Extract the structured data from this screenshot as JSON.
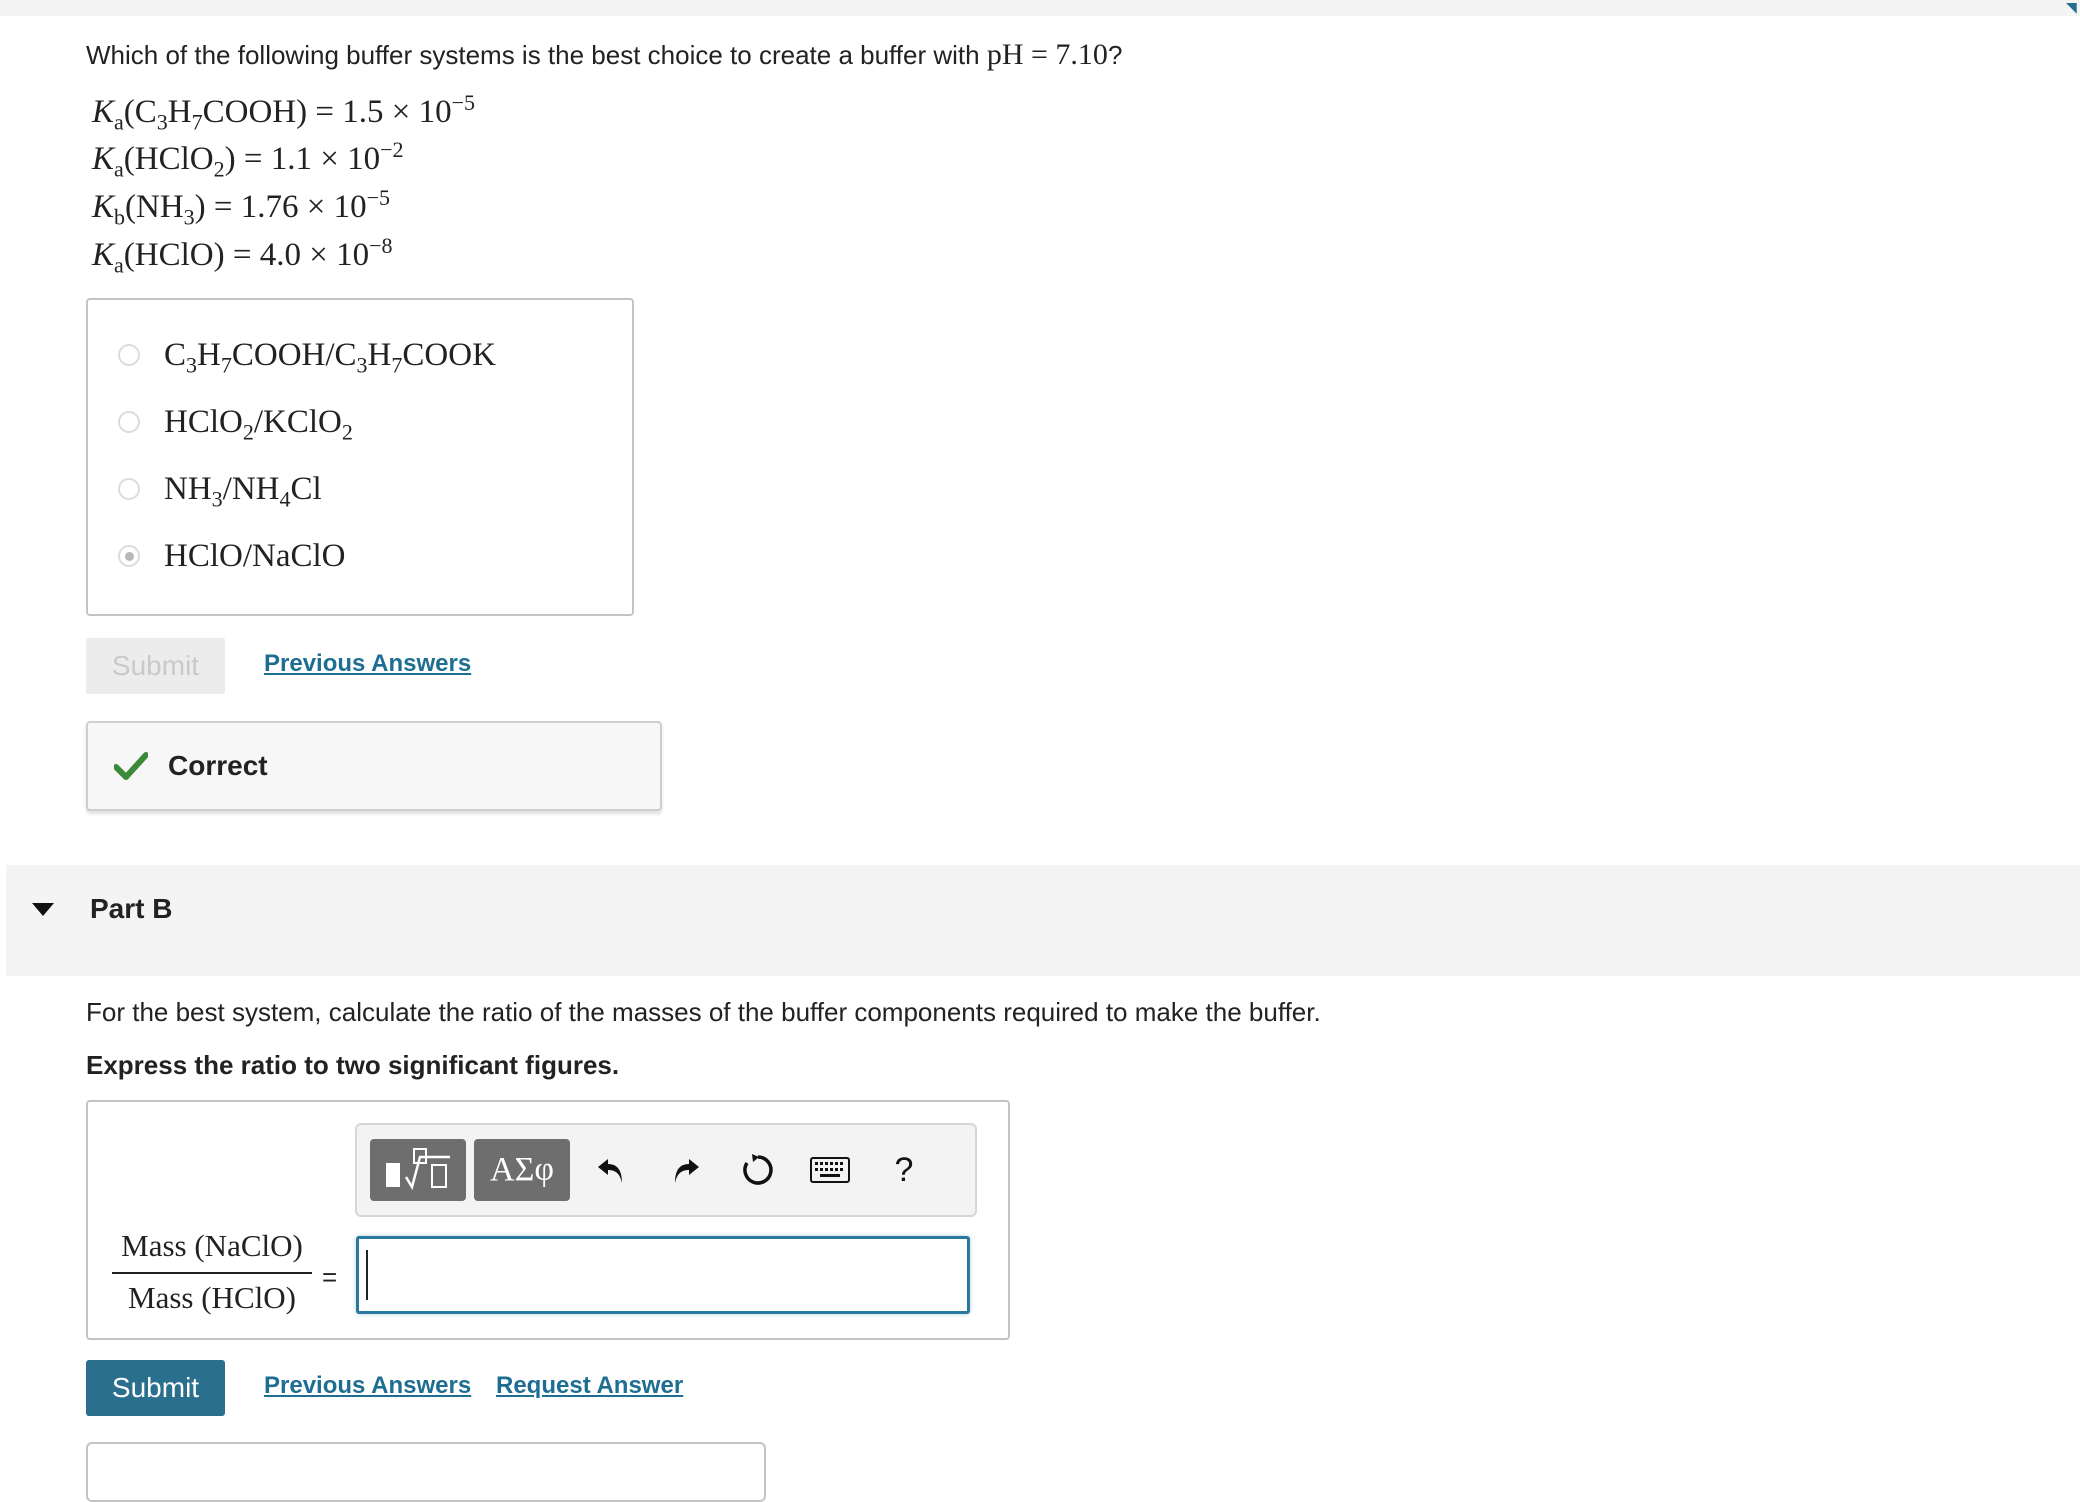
{
  "part_a": {
    "question_text": "Which of the following buffer systems is the best choice to create a buffer with",
    "question_ph": "pH = 7.10",
    "question_end": "?",
    "constants": [
      {
        "symbol": "K",
        "sub": "a",
        "species_html": "(C<sub>3</sub>H<sub>7</sub>COOH) = 1.5 × 10<sup>−5</sup>"
      },
      {
        "symbol": "K",
        "sub": "a",
        "species_html": "(HClO<sub>2</sub>) = 1.1 × 10<sup>−2</sup>"
      },
      {
        "symbol": "K",
        "sub": "b",
        "species_html": "(NH<sub>3</sub>) = 1.76 × 10<sup>−5</sup>"
      },
      {
        "symbol": "K",
        "sub": "a",
        "species_html": "(HClO) = 4.0 × 10<sup>−8</sup>"
      }
    ],
    "choices": [
      {
        "label_html": "C<sub>3</sub>H<sub>7</sub>COOH/C<sub>3</sub>H<sub>7</sub>COOK",
        "selected": false
      },
      {
        "label_html": "HClO<sub>2</sub>/KClO<sub>2</sub>",
        "selected": false
      },
      {
        "label_html": "NH<sub>3</sub>/NH<sub>4</sub>Cl",
        "selected": false
      },
      {
        "label_html": "HClO/NaClO",
        "selected": true
      }
    ],
    "submit_label": "Submit",
    "previous_answers_label": "Previous Answers",
    "feedback": "Correct"
  },
  "part_b": {
    "title": "Part B",
    "prompt": "For the best system, calculate the ratio of the masses of the buffer components required to make the buffer.",
    "instruction": "Express the ratio to two significant figures.",
    "toolbar": {
      "greek_label": "ΑΣφ",
      "help_label": "?"
    },
    "fraction_numerator": "Mass (NaClO)",
    "fraction_denominator": "Mass (HClO)",
    "equals": "=",
    "answer_value": "",
    "submit_label": "Submit",
    "previous_answers_label": "Previous Answers",
    "request_answer_label": "Request Answer"
  },
  "colors": {
    "accent": "#2b6f8e",
    "link": "#1e6e93",
    "correct_green": "#3a8a3a"
  }
}
